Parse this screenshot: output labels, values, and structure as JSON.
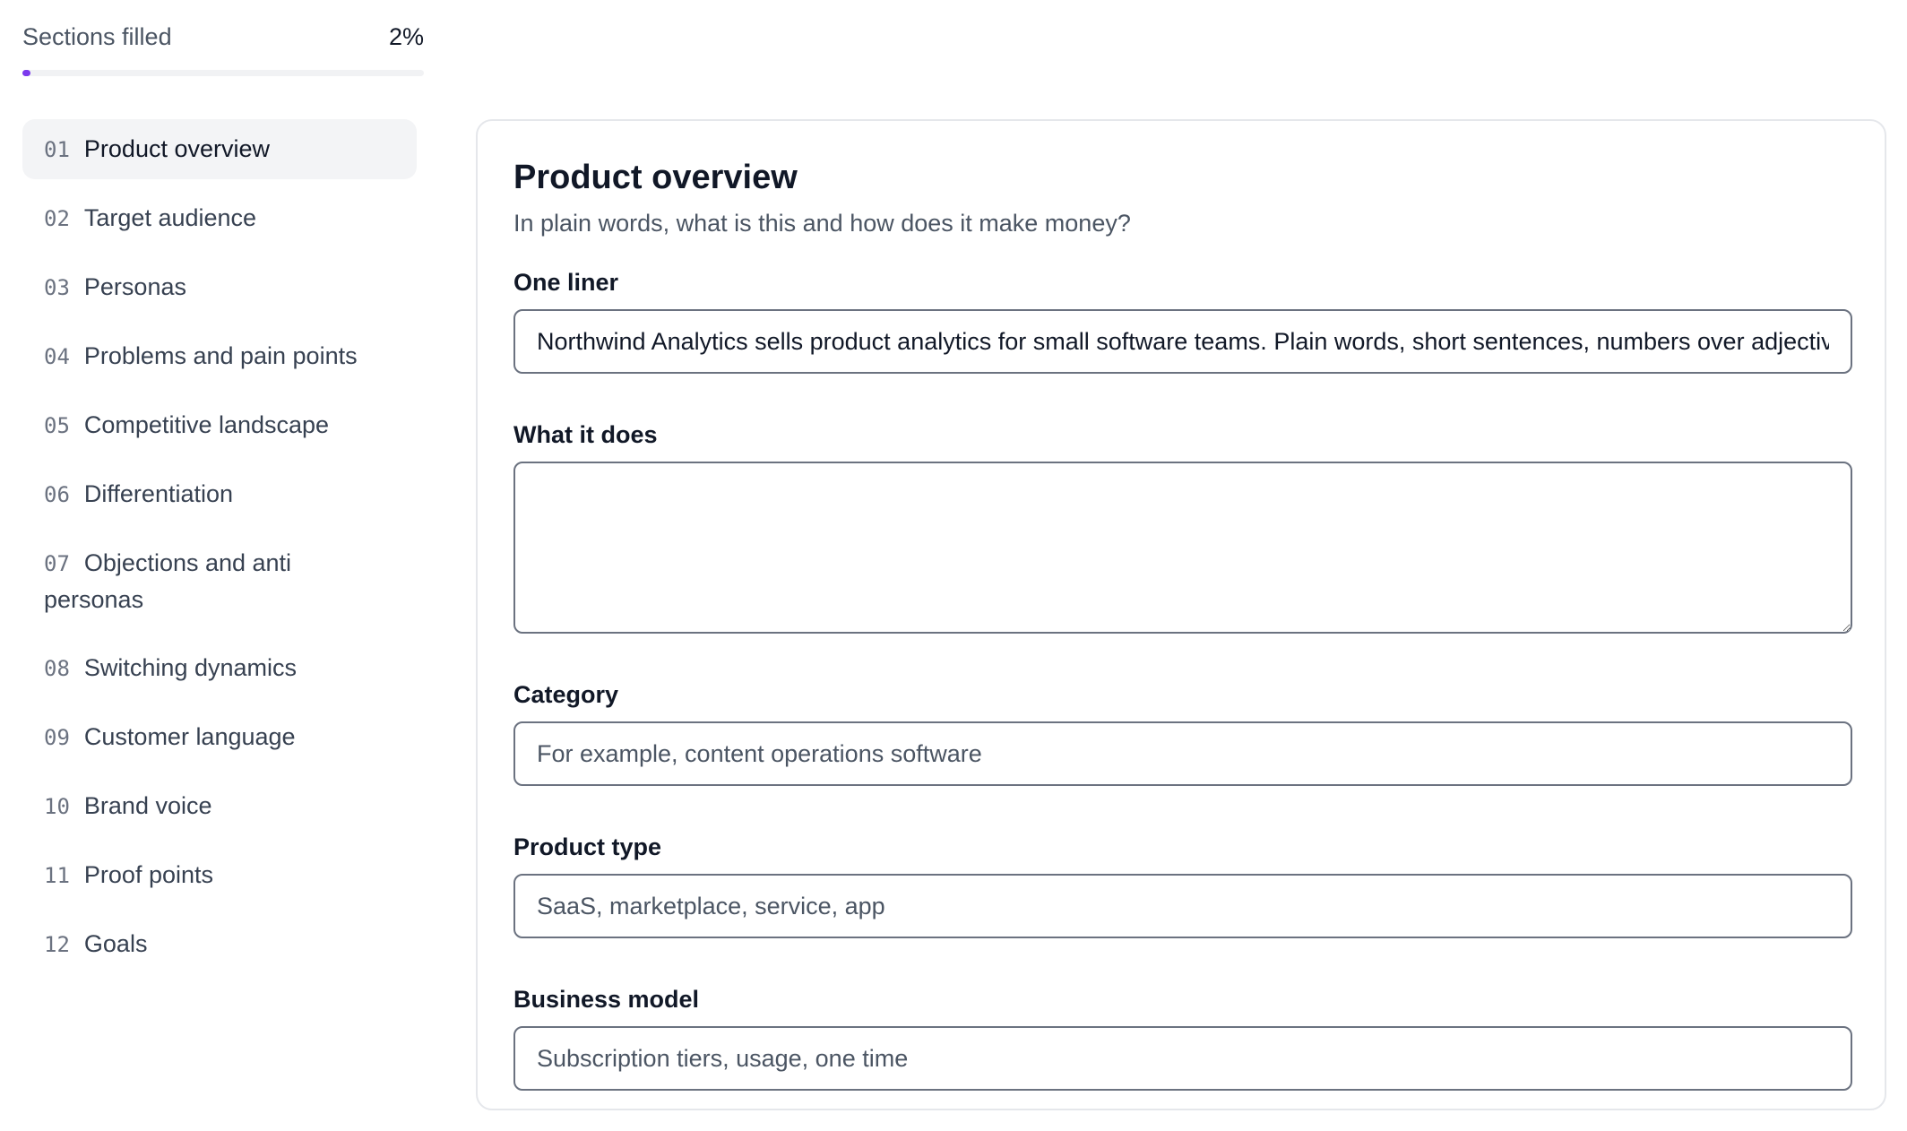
{
  "progress": {
    "label": "Sections filled",
    "value_text": "2%",
    "fraction": 0.02,
    "accent_color": "#7c3aed"
  },
  "nav": {
    "items": [
      {
        "num": "01",
        "label": "Product overview",
        "active": true
      },
      {
        "num": "02",
        "label": "Target audience"
      },
      {
        "num": "03",
        "label": "Personas"
      },
      {
        "num": "04",
        "label": "Problems and pain points"
      },
      {
        "num": "05",
        "label": "Competitive landscape"
      },
      {
        "num": "06",
        "label": "Differentiation"
      },
      {
        "num": "07",
        "label": "Objections and anti personas"
      },
      {
        "num": "08",
        "label": "Switching dynamics"
      },
      {
        "num": "09",
        "label": "Customer language"
      },
      {
        "num": "10",
        "label": "Brand voice"
      },
      {
        "num": "11",
        "label": "Proof points"
      },
      {
        "num": "12",
        "label": "Goals"
      }
    ]
  },
  "section": {
    "title": "Product overview",
    "subtitle": "In plain words, what is this and how does it make money?",
    "fields": {
      "one_liner": {
        "label": "One liner",
        "value": "Northwind Analytics sells product analytics for small software teams. Plain words, short sentences, numbers over adjectives."
      },
      "what_it_does": {
        "label": "What it does",
        "value": ""
      },
      "category": {
        "label": "Category",
        "placeholder": "For example, content operations software"
      },
      "product_type": {
        "label": "Product type",
        "placeholder": "SaaS, marketplace, service, app"
      },
      "business_model": {
        "label": "Business model",
        "placeholder": "Subscription tiers, usage, one time"
      }
    }
  }
}
